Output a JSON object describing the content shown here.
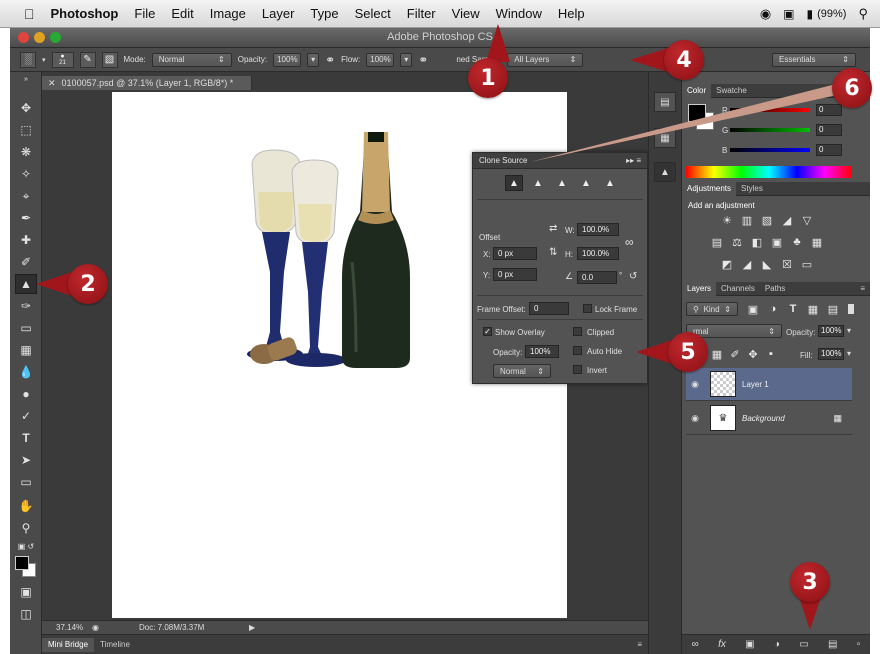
{
  "menubar": {
    "app": "Photoshop",
    "menus": [
      "File",
      "Edit",
      "Image",
      "Layer",
      "Type",
      "Select",
      "Filter",
      "View",
      "Window",
      "Help"
    ],
    "battery": "(99%)"
  },
  "titlebar": {
    "title": "Adobe Photoshop CS"
  },
  "options": {
    "brush_size": "21",
    "mode_label": "Mode:",
    "mode_value": "Normal",
    "opacity_label": "Opacity:",
    "opacity_value": "100%",
    "flow_label": "Flow:",
    "flow_value": "100%",
    "sample_label": "ned Sample:",
    "sample_value": "All Layers",
    "workspace": "Essentials"
  },
  "document": {
    "tab": "0100057.psd @ 37.1% (Layer 1, RGB/8*) *",
    "zoom": "37.14%",
    "doc_size": "Doc: 7.08M/3.37M"
  },
  "bottom_tabs": [
    "Mini Bridge",
    "Timeline"
  ],
  "clone_source": {
    "title": "Clone Source",
    "offset_label": "Offset",
    "x_label": "X:",
    "x_value": "0 px",
    "y_label": "Y:",
    "y_value": "0 px",
    "w_label": "W:",
    "w_value": "100.0%",
    "h_label": "H:",
    "h_value": "100.0%",
    "angle_value": "0.0",
    "angle_unit": "°",
    "frame_offset_label": "Frame Offset:",
    "frame_offset_value": "0",
    "lock_frame": "Lock Frame",
    "show_overlay": "Show Overlay",
    "overlay_opacity_label": "Opacity:",
    "overlay_opacity_value": "100%",
    "blend_value": "Normal",
    "clipped": "Clipped",
    "auto_hide": "Auto Hide",
    "invert": "Invert"
  },
  "color_panel": {
    "tabs": [
      "Color",
      "Swatche"
    ],
    "channels": [
      {
        "label": "R",
        "value": "0"
      },
      {
        "label": "G",
        "value": "0"
      },
      {
        "label": "B",
        "value": "0"
      }
    ]
  },
  "adjustments_panel": {
    "tabs": [
      "Adjustments",
      "Styles"
    ],
    "hint": "Add an adjustment"
  },
  "layers_panel": {
    "tabs": [
      "Layers",
      "Channels",
      "Paths"
    ],
    "filter": "Kind",
    "blend": "rmal",
    "opacity_label": "Opacity:",
    "opacity_value": "100%",
    "fill_label": "Fill:",
    "fill_value": "100%",
    "layers": [
      {
        "name": "Layer 1"
      },
      {
        "name": "Background"
      }
    ]
  },
  "callouts": [
    "1",
    "2",
    "3",
    "4",
    "5",
    "6"
  ],
  "colors": {
    "callout": "#a0161b",
    "panel": "#535353",
    "selected_layer": "#5b6a8c"
  }
}
